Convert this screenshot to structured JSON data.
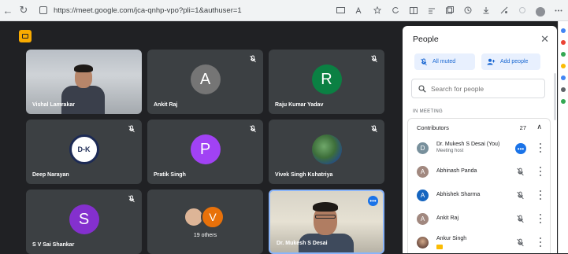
{
  "browser": {
    "url": "https://meet.google.com/jca-qnhp-vpo?pli=1&authuser=1",
    "back_glyph": "←",
    "reload_glyph": "↻"
  },
  "tiles": [
    {
      "name": "Vishal Lamrakar",
      "type": "video",
      "muted": false
    },
    {
      "name": "Ankit Raj",
      "type": "avatar",
      "initial": "A",
      "color": "#757575",
      "muted": true
    },
    {
      "name": "Raju Kumar Yadav",
      "type": "avatar",
      "initial": "R",
      "color": "#0b8043",
      "muted": true
    },
    {
      "name": "Deep Narayan",
      "type": "logo",
      "logo_text": "D-K",
      "muted": true
    },
    {
      "name": "Pratik Singh",
      "type": "avatar",
      "initial": "P",
      "color": "#a142f4",
      "muted": true
    },
    {
      "name": "Vivek Singh Kshatriya",
      "type": "photo",
      "muted": true
    },
    {
      "name": "S V Sai Shankar",
      "type": "avatar",
      "initial": "S",
      "color": "#8430ce",
      "muted": true
    },
    {
      "name": "",
      "type": "others",
      "label": "19 others",
      "initial": "V"
    },
    {
      "name": "Dr. Mukesh S Desai",
      "type": "video",
      "muted": false
    }
  ],
  "panel": {
    "title": "People",
    "close_glyph": "✕",
    "mute_all_label": "All muted",
    "add_people_label": "Add people",
    "search_placeholder": "Search for people",
    "section_label": "IN MEETING",
    "group_title": "Contributors",
    "group_count": "27",
    "group_chevron": "∧",
    "participants": [
      {
        "name": "Dr. Mukesh S Desai (You)",
        "subtitle": "Meeting host",
        "initial": "D",
        "color": "#78909c",
        "state": "host"
      },
      {
        "name": "Abhinash Panda",
        "subtitle": "",
        "initial": "A",
        "color": "#a1887f",
        "state": "muted"
      },
      {
        "name": "Abhishek Sharma",
        "subtitle": "",
        "initial": "A",
        "color": "#1565c0",
        "state": "muted"
      },
      {
        "name": "Ankit Raj",
        "subtitle": "",
        "initial": "A",
        "color": "#a1887f",
        "state": "muted"
      },
      {
        "name": "Ankur Singh",
        "subtitle": "",
        "initial": "",
        "color": "#8d6e63",
        "state": "muted"
      }
    ]
  },
  "colors": {
    "stage_bg": "#202124",
    "tile_bg": "#3c4043",
    "accent": "#1a73e8",
    "chip_bg": "#e8f0fe",
    "chip_text": "#1967d2"
  }
}
